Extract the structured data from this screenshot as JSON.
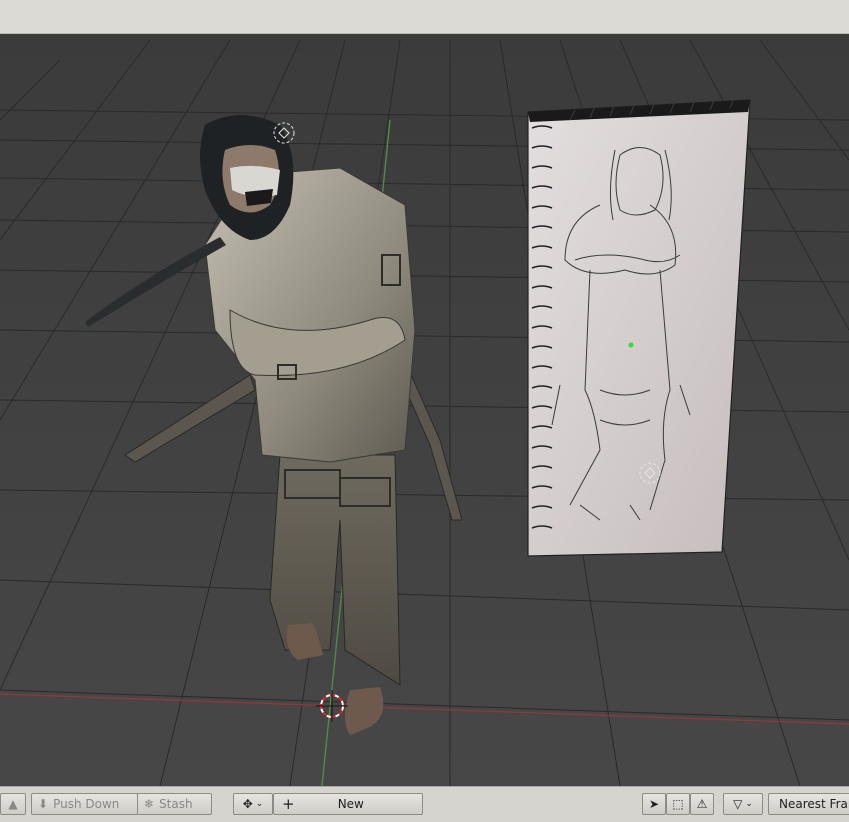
{
  "toolbar": {
    "push_down_label": "Push Down",
    "stash_label": "Stash",
    "new_label": "New",
    "nearest_frame_label": "Nearest Fran"
  },
  "colors": {
    "viewport_bg": "#3d3d3d",
    "grid_line": "#2a2a2a",
    "x_axis": "#8a3a3a",
    "y_axis": "#4f8a4f",
    "active_tool": "#2f4f8f"
  },
  "icons": [
    "push-down-icon",
    "stash-icon",
    "keying-set-icon",
    "plus-icon",
    "select-cursor-icon",
    "select-box-icon",
    "warning-icon",
    "filter-icon",
    "chevron-down-icon",
    "3d-cursor-icon",
    "origin-point-icon"
  ]
}
